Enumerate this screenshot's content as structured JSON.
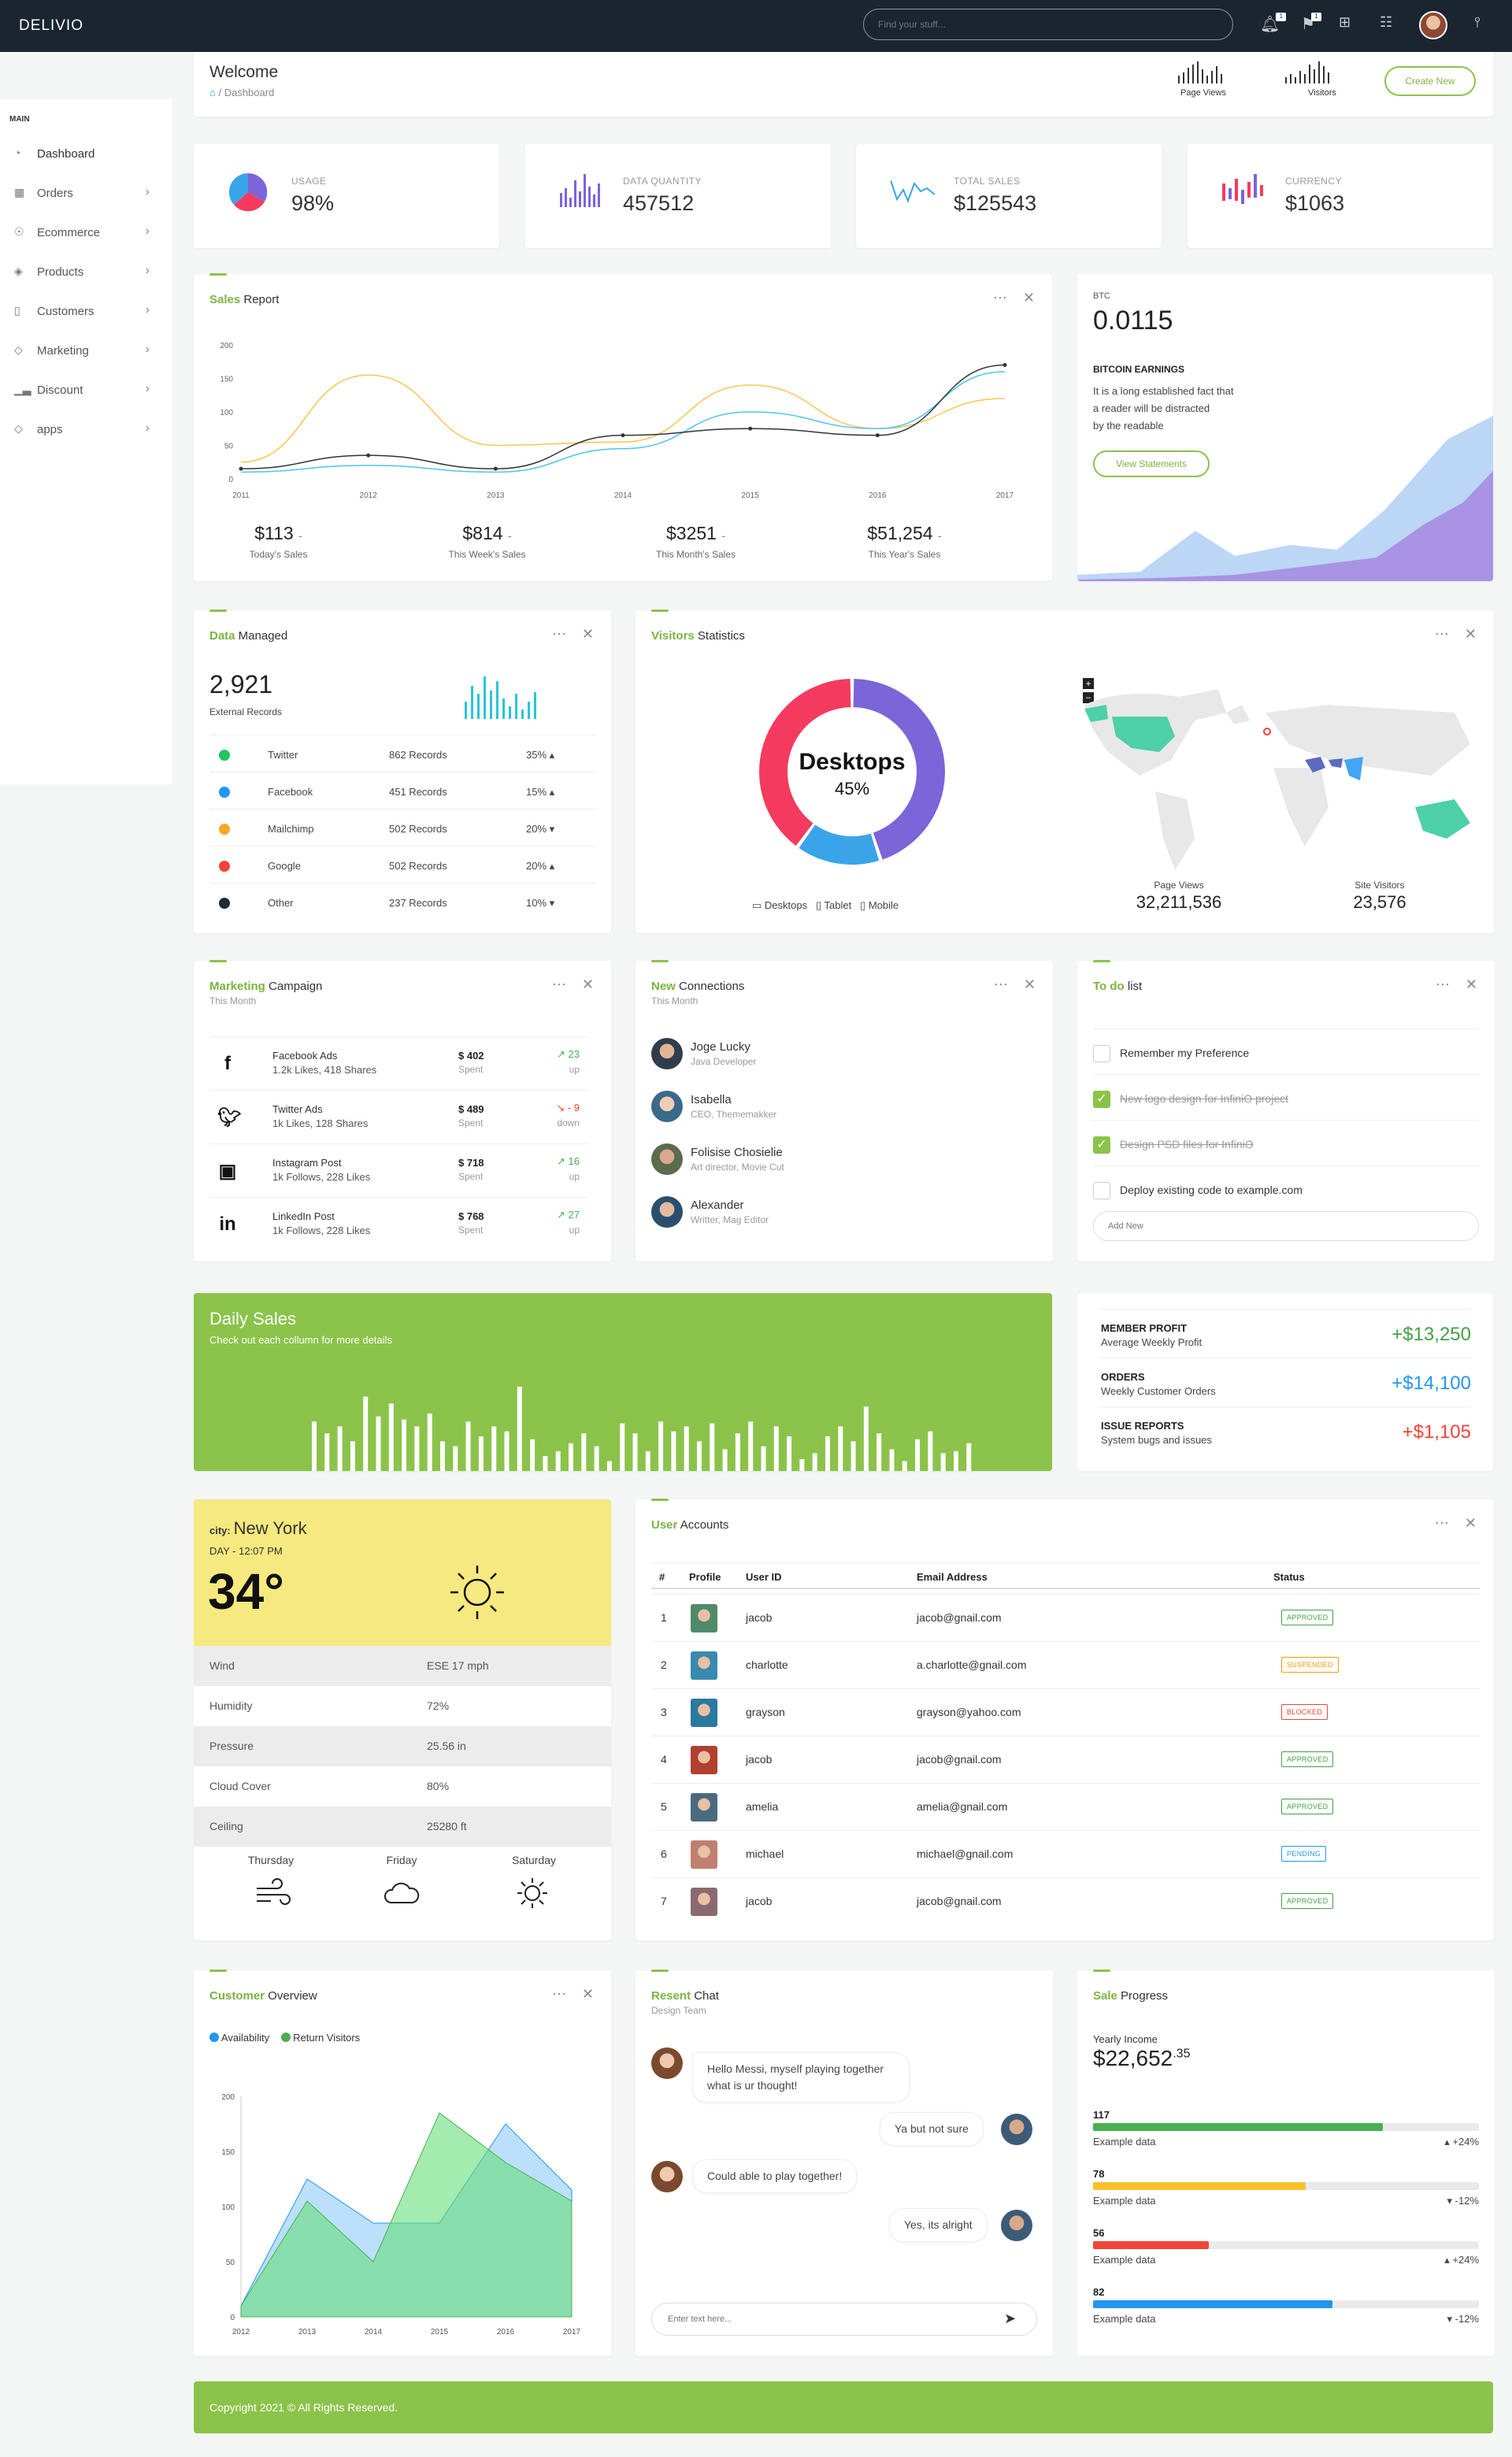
{
  "app": {
    "name": "DELIVIO"
  },
  "topbar": {
    "search_placeholder": "Find your stuff...",
    "notifications_badge": "1",
    "flags_badge": "1"
  },
  "sidebar": {
    "section": "MAIN",
    "items": [
      {
        "label": "Dashboard",
        "icon": "gauge-icon"
      },
      {
        "label": "Orders",
        "icon": "grid-icon"
      },
      {
        "label": "Ecommerce",
        "icon": "cart-icon"
      },
      {
        "label": "Products",
        "icon": "layers-icon"
      },
      {
        "label": "Customers",
        "icon": "file-icon"
      },
      {
        "label": "Marketing",
        "icon": "tag-icon"
      },
      {
        "label": "Discount",
        "icon": "bar-chart-icon"
      },
      {
        "label": "apps",
        "icon": "tags-icon"
      }
    ]
  },
  "header": {
    "title": "Welcome",
    "breadcrumb": "Dashboard",
    "page_views_label": "Page Views",
    "visitors_label": "Visitors",
    "create_new": "Create New"
  },
  "stats": [
    {
      "label": "USAGE",
      "value": "98%"
    },
    {
      "label": "DATA QUANTITY",
      "value": "457512"
    },
    {
      "label": "TOTAL SALES",
      "value": "$125543"
    },
    {
      "label": "CURRENCY",
      "value": "$1063"
    }
  ],
  "sales_report": {
    "title_bold": "Sales",
    "title_rest": " Report",
    "summary": [
      {
        "value": "$113",
        "label": "Today's Sales",
        "dir": "-",
        "color": "#26a69a"
      },
      {
        "value": "$814",
        "label": "This Week's Sales",
        "dir": "-",
        "color": "#f44336"
      },
      {
        "value": "$3251",
        "label": "This Month's Sales",
        "dir": "-",
        "color": "#26a69a"
      },
      {
        "value": "$51,254",
        "label": "This Year's Sales",
        "dir": "-",
        "color": "#26a69a"
      }
    ]
  },
  "chart_data": [
    {
      "type": "line",
      "x": [
        "2011",
        "2012",
        "2013",
        "2014",
        "2015",
        "2016",
        "2017"
      ],
      "ylim": [
        0,
        200
      ],
      "yticks": [
        "0",
        "50",
        "100",
        "150",
        "200"
      ],
      "series": [
        {
          "color": "#f9c74f",
          "values": [
            25,
            155,
            50,
            55,
            140,
            75,
            120
          ]
        },
        {
          "color": "#4fc3f7",
          "values": [
            10,
            20,
            10,
            45,
            100,
            75,
            160
          ]
        },
        {
          "color": "#333333",
          "values": [
            15,
            35,
            15,
            65,
            75,
            65,
            170
          ]
        }
      ]
    },
    {
      "type": "area",
      "x": [
        "2012",
        "2013",
        "2014",
        "2015",
        "2016",
        "2017"
      ],
      "ylim": [
        0,
        200
      ],
      "yticks": [
        "0",
        "50",
        "100",
        "150",
        "200"
      ],
      "legend": [
        "Availability",
        "Return Visitors"
      ],
      "series": [
        {
          "name": "Availability",
          "color": "#2196f3",
          "values": [
            10,
            125,
            85,
            85,
            175,
            115
          ]
        },
        {
          "name": "Return Visitors",
          "color": "#4caf50",
          "values": [
            10,
            105,
            50,
            185,
            140,
            105
          ]
        }
      ]
    },
    {
      "type": "bar",
      "values": [
        50,
        38,
        45,
        30,
        75,
        55,
        68,
        52,
        45,
        58,
        30,
        25,
        50,
        35,
        45,
        40,
        85,
        32,
        15,
        20,
        28,
        38,
        25,
        10,
        48,
        38,
        20,
        50,
        40,
        45,
        30,
        48,
        22,
        38,
        50,
        25,
        45,
        35,
        12,
        18,
        35,
        45,
        30,
        65,
        38,
        22,
        10,
        32,
        40,
        18,
        20,
        28
      ]
    },
    {
      "type": "pie",
      "categories": [
        "Desktops",
        "Tablet",
        "Mobile"
      ],
      "values": [
        45,
        15,
        40
      ],
      "colors": [
        "#7c64d9",
        "#39a5e8",
        "#f43b5f"
      ]
    }
  ],
  "btc": {
    "label": "BTC",
    "value": "0.0115",
    "heading": "BITCOIN EARNINGS",
    "text": [
      "It is a long established fact that",
      "a reader will be distracted",
      "by the readable"
    ],
    "button": "View Statements"
  },
  "data_managed": {
    "title_bold": "Data",
    "title_rest": " Managed",
    "total": "2,921",
    "total_label": "External Records",
    "rows": [
      {
        "name": "Twitter",
        "records": "862 Records",
        "pct": "35% ▴",
        "color": "#22c55e"
      },
      {
        "name": "Facebook",
        "records": "451 Records",
        "pct": "15% ▴",
        "color": "#2196f3"
      },
      {
        "name": "Mailchimp",
        "records": "502 Records",
        "pct": "20% ▾",
        "color": "#f9a825"
      },
      {
        "name": "Google",
        "records": "502 Records",
        "pct": "20% ▴",
        "color": "#f44336"
      },
      {
        "name": "Other",
        "records": "237 Records",
        "pct": "10% ▾",
        "color": "#1e2a38"
      }
    ]
  },
  "visitors": {
    "title_bold": "Visitors",
    "title_rest": " Statistics",
    "center_label": "Desktops",
    "center_value": "45%",
    "legend": [
      "Desktops",
      "Tablet",
      "Mobile"
    ],
    "page_views_label": "Page Views",
    "page_views": "32,211,536",
    "site_visitors_label": "Site Visitors",
    "site_visitors": "23,576"
  },
  "marketing": {
    "title_bold": "Marketing",
    "title_rest": " Campaign",
    "subtitle": "This Month",
    "rows": [
      {
        "icon": "f",
        "name": "Facebook Ads",
        "stats": "1.2k Likes, 418 Shares",
        "amount": "$ 402",
        "spent": "Spent",
        "trend": "23",
        "dir": "up",
        "color": "#4caf50"
      },
      {
        "icon": "t",
        "name": "Twitter Ads",
        "stats": "1k Likes, 128 Shares",
        "amount": "$ 489",
        "spent": "Spent",
        "trend": "9",
        "dir": "down",
        "color": "#f44336"
      },
      {
        "icon": "i",
        "name": "Instagram Post",
        "stats": "1k Follows, 228 Likes",
        "amount": "$ 718",
        "spent": "Spent",
        "trend": "16",
        "dir": "up",
        "color": "#4caf50"
      },
      {
        "icon": "in",
        "name": "LinkedIn Post",
        "stats": "1k Follows, 228 Likes",
        "amount": "$ 768",
        "spent": "Spent",
        "trend": "27",
        "dir": "up",
        "color": "#4caf50"
      }
    ]
  },
  "connections": {
    "title_bold": "New",
    "title_rest": " Connections",
    "subtitle": "This Month",
    "people": [
      {
        "name": "Joge Lucky",
        "role": "Java Developer"
      },
      {
        "name": "Isabella",
        "role": "CEO, Thememakker"
      },
      {
        "name": "Folisise Chosielie",
        "role": "Art director, Movie Cut"
      },
      {
        "name": "Alexander",
        "role": "Writter, Mag Editor"
      }
    ]
  },
  "todo": {
    "title_bold": "To do",
    "title_rest": " list",
    "items": [
      {
        "text": "Remember my Preference",
        "done": false
      },
      {
        "text": "New logo design for InfiniO project",
        "done": true
      },
      {
        "text": "Design PSD files for InfiniO",
        "done": true
      },
      {
        "text": "Deploy existing code to example.com",
        "done": false
      }
    ],
    "add_placeholder": "Add New"
  },
  "daily_sales": {
    "title": "Daily Sales",
    "subtitle": "Check out each collumn for more details"
  },
  "metrics": [
    {
      "title": "MEMBER PROFIT",
      "sub": "Average Weekly Profit",
      "value": "+$13,250",
      "color": "#43a047"
    },
    {
      "title": "ORDERS",
      "sub": "Weekly Customer Orders",
      "value": "+$14,100",
      "color": "#2196f3"
    },
    {
      "title": "ISSUE REPORTS",
      "sub": "System bugs and issues",
      "value": "+$1,105",
      "color": "#f44336"
    }
  ],
  "weather": {
    "city_label": "city:",
    "city": "New York",
    "day": "DAY - 12:07 PM",
    "temp": "34°",
    "rows": [
      {
        "k": "Wind",
        "v": "ESE 17 mph"
      },
      {
        "k": "Humidity",
        "v": "72%"
      },
      {
        "k": "Pressure",
        "v": "25.56 in"
      },
      {
        "k": "Cloud Cover",
        "v": "80%"
      },
      {
        "k": "Ceiling",
        "v": "25280 ft"
      }
    ],
    "days": [
      "Thursday",
      "Friday",
      "Saturday"
    ]
  },
  "users": {
    "title_bold": "User",
    "title_rest": " Accounts",
    "headers": [
      "#",
      "Profile",
      "User ID",
      "Email Address",
      "Status"
    ],
    "rows": [
      {
        "n": "1",
        "id": "jacob",
        "email": "jacob@gnail.com",
        "status": "APPROVED",
        "color": "#43a047"
      },
      {
        "n": "2",
        "id": "charlotte",
        "email": "a.charlotte@gnail.com",
        "status": "SUSPENDED",
        "color": "#ff9800"
      },
      {
        "n": "3",
        "id": "grayson",
        "email": "grayson@yahoo.com",
        "status": "BLOCKED",
        "color": "#f44336"
      },
      {
        "n": "4",
        "id": "jacob",
        "email": "jacob@gnail.com",
        "status": "APPROVED",
        "color": "#43a047"
      },
      {
        "n": "5",
        "id": "amelia",
        "email": "amelia@gnail.com",
        "status": "APPROVED",
        "color": "#43a047"
      },
      {
        "n": "6",
        "id": "michael",
        "email": "michael@gnail.com",
        "status": "PENDING",
        "color": "#2196f3"
      },
      {
        "n": "7",
        "id": "jacob",
        "email": "jacob@gnail.com",
        "status": "APPROVED",
        "color": "#43a047"
      }
    ]
  },
  "customer": {
    "title_bold": "Customer",
    "title_rest": " Overview"
  },
  "chat": {
    "title_bold": "Resent",
    "title_rest": " Chat",
    "subtitle": "Design Team",
    "msg1": "Hello Messi, myself playing together what is ur thought!",
    "msg2": "Ya but not sure",
    "msg3": "Could able to play together!",
    "msg4": "Yes, its alright",
    "input_placeholder": "Enter text here..."
  },
  "sale_progress": {
    "title_bold": "Sale",
    "title_rest": " Progress",
    "income_label": "Yearly Income",
    "income": "$22,652",
    "income_cents": ".35",
    "rows": [
      {
        "n": "117",
        "label": "Example data",
        "pct": "+24%",
        "dir": "▴",
        "fill": 0.75,
        "color": "#4caf50"
      },
      {
        "n": "78",
        "label": "Example data",
        "pct": "-12%",
        "dir": "▾",
        "fill": 0.55,
        "color": "#fbc02d"
      },
      {
        "n": "56",
        "label": "Example data",
        "pct": "+24%",
        "dir": "▴",
        "fill": 0.3,
        "color": "#f44336"
      },
      {
        "n": "82",
        "label": "Example data",
        "pct": "-12%",
        "dir": "▾",
        "fill": 0.62,
        "color": "#2196f3"
      }
    ]
  },
  "footer": {
    "text": "Copyright 2021 © All Rights Reserved."
  }
}
